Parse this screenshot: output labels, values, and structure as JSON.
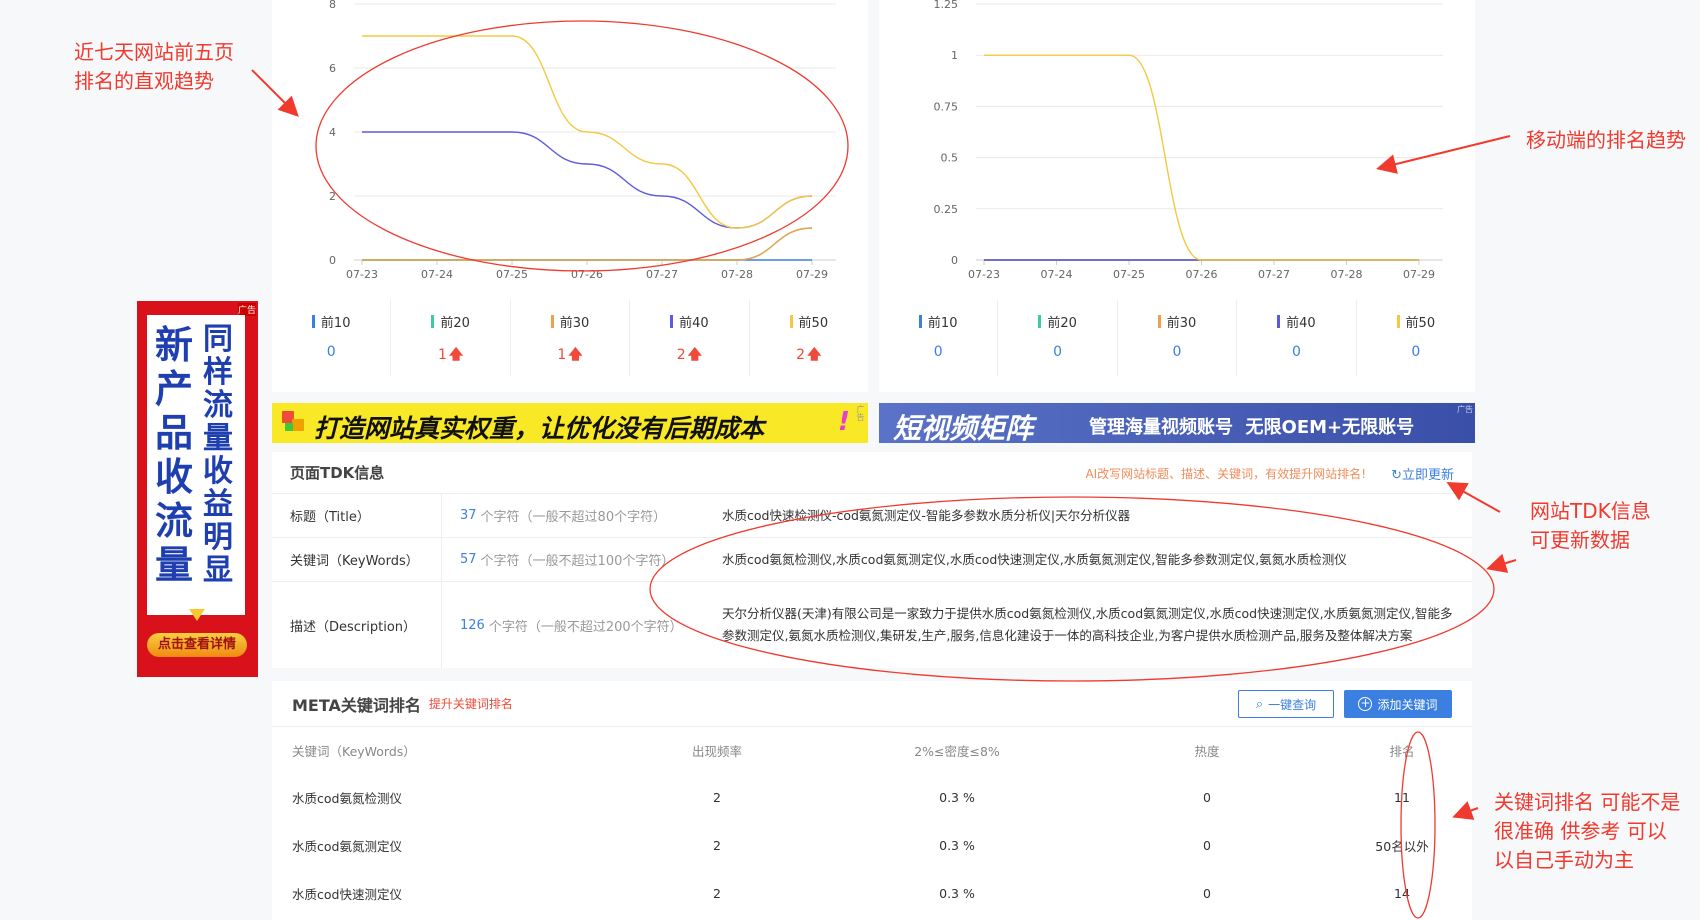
{
  "charts": {
    "pc": {
      "y_ticks": [
        "0",
        "2",
        "4",
        "6",
        "8"
      ],
      "x_ticks": [
        "07-23",
        "07-24",
        "07-25",
        "07-26",
        "07-27",
        "07-28",
        "07-29"
      ]
    },
    "mobile": {
      "y_ticks": [
        "0",
        "0.25",
        "0.5",
        "0.75",
        "1",
        "1.25"
      ],
      "x_ticks": [
        "07-23",
        "07-24",
        "07-25",
        "07-26",
        "07-27",
        "07-28",
        "07-29"
      ]
    }
  },
  "chart_data": [
    {
      "type": "line",
      "x": [
        "07-23",
        "07-24",
        "07-25",
        "07-26",
        "07-27",
        "07-28",
        "07-29"
      ],
      "ylim": [
        0,
        8
      ],
      "series": [
        {
          "name": "前10",
          "color": "#3b7fe0",
          "values": [
            0,
            0,
            0,
            0,
            0,
            0,
            0
          ]
        },
        {
          "name": "前20",
          "color": "#3ec9a7",
          "values": [
            0,
            0,
            0,
            0,
            0,
            0,
            1
          ]
        },
        {
          "name": "前30",
          "color": "#f0a04b",
          "values": [
            0,
            0,
            0,
            0,
            0,
            0,
            1
          ]
        },
        {
          "name": "前40",
          "color": "#5b5be0",
          "values": [
            4,
            4,
            4,
            3,
            2,
            1,
            2
          ]
        },
        {
          "name": "前50",
          "color": "#f5c842",
          "values": [
            7,
            7,
            7,
            4,
            3,
            1,
            2
          ]
        }
      ]
    },
    {
      "type": "line",
      "x": [
        "07-23",
        "07-24",
        "07-25",
        "07-26",
        "07-27",
        "07-28",
        "07-29"
      ],
      "ylim": [
        0,
        1.25
      ],
      "series": [
        {
          "name": "前10",
          "color": "#3b7fe0",
          "values": [
            0,
            0,
            0,
            0,
            0,
            0,
            0
          ]
        },
        {
          "name": "前20",
          "color": "#3ec9a7",
          "values": [
            0,
            0,
            0,
            0,
            0,
            0,
            0
          ]
        },
        {
          "name": "前30",
          "color": "#f0a04b",
          "values": [
            0,
            0,
            0,
            0,
            0,
            0,
            0
          ]
        },
        {
          "name": "前40",
          "color": "#5b5be0",
          "values": [
            0,
            0,
            0,
            0,
            0,
            0,
            0
          ]
        },
        {
          "name": "前50",
          "color": "#f5c842",
          "values": [
            1,
            1,
            1,
            0,
            0,
            0,
            0
          ]
        }
      ]
    }
  ],
  "legend_pc": [
    {
      "label": "前10",
      "color": "#3b7fe0",
      "value": "0",
      "trend": ""
    },
    {
      "label": "前20",
      "color": "#3ec9a7",
      "value": "1",
      "trend": "up"
    },
    {
      "label": "前30",
      "color": "#f0a04b",
      "value": "1",
      "trend": "up"
    },
    {
      "label": "前40",
      "color": "#5b5be0",
      "value": "2",
      "trend": "up"
    },
    {
      "label": "前50",
      "color": "#f5c842",
      "value": "2",
      "trend": "up"
    }
  ],
  "legend_mobile": [
    {
      "label": "前10",
      "color": "#3b7fe0",
      "value": "0"
    },
    {
      "label": "前20",
      "color": "#3ec9a7",
      "value": "0"
    },
    {
      "label": "前30",
      "color": "#f0a04b",
      "value": "0"
    },
    {
      "label": "前40",
      "color": "#5b5be0",
      "value": "0"
    },
    {
      "label": "前50",
      "color": "#f5c842",
      "value": "0"
    }
  ],
  "banners": {
    "left_text": "打造网站真实权重，让优化没有后期成本",
    "ad_tag": "广告",
    "right_title": "短视频矩阵",
    "right_text": "管理海量视频账号  无限OEM+无限账号"
  },
  "vertical_ad": {
    "tag": "广告",
    "col1": "新产品收流量",
    "col2": "同样流量收益明显",
    "button": "点击查看详情"
  },
  "tdk": {
    "title": "页面TDK信息",
    "ai_link": "AI改写网站标题、描述、关键词，有效提升网站排名!",
    "update": "立即更新",
    "rows": [
      {
        "label": "标题（Title）",
        "count": "37",
        "unit": "个字符（一般不超过80个字符）",
        "content": "水质cod快速检测仪-cod氨氮测定仪-智能多参数水质分析仪|天尔分析仪器"
      },
      {
        "label": "关键词（KeyWords）",
        "count": "57",
        "unit": "个字符（一般不超过100个字符）",
        "content": "水质cod氨氮检测仪,水质cod氨氮测定仪,水质cod快速测定仪,水质氨氮测定仪,智能多参数测定仪,氨氮水质检测仪"
      },
      {
        "label": "描述（Description）",
        "count": "126",
        "unit": "个字符（一般不超过200个字符）",
        "content": "天尔分析仪器(天津)有限公司是一家致力于提供水质cod氨氮检测仪,水质cod氨氮测定仪,水质cod快速测定仪,水质氨氮测定仪,智能多参数测定仪,氨氮水质检测仪,集研发,生产,服务,信息化建设于一体的高科技企业,为客户提供水质检测产品,服务及整体解决方案"
      }
    ]
  },
  "meta": {
    "title": "META关键词排名",
    "sub": "提升关键词排名",
    "query_btn": "一键查询",
    "add_btn": "添加关键词",
    "headers": [
      "关键词（KeyWords）",
      "出现频率",
      "2%≤密度≤8%",
      "热度",
      "排名"
    ],
    "rows": [
      [
        "水质cod氨氮检测仪",
        "2",
        "0.3 %",
        "0",
        "11"
      ],
      [
        "水质cod氨氮测定仪",
        "2",
        "0.3 %",
        "0",
        "50名以外"
      ],
      [
        "水质cod快速测定仪",
        "2",
        "0.3 %",
        "0",
        "14"
      ]
    ]
  },
  "annotations": {
    "a1": [
      "近七天网站前五页",
      "排名的直观趋势"
    ],
    "a2": "移动端的排名趋势",
    "a3": [
      "网站TDK信息",
      "可更新数据"
    ],
    "a4": [
      "关键词排名 可能不是",
      "很准确 供参考 可以",
      "以自己手动为主"
    ]
  }
}
